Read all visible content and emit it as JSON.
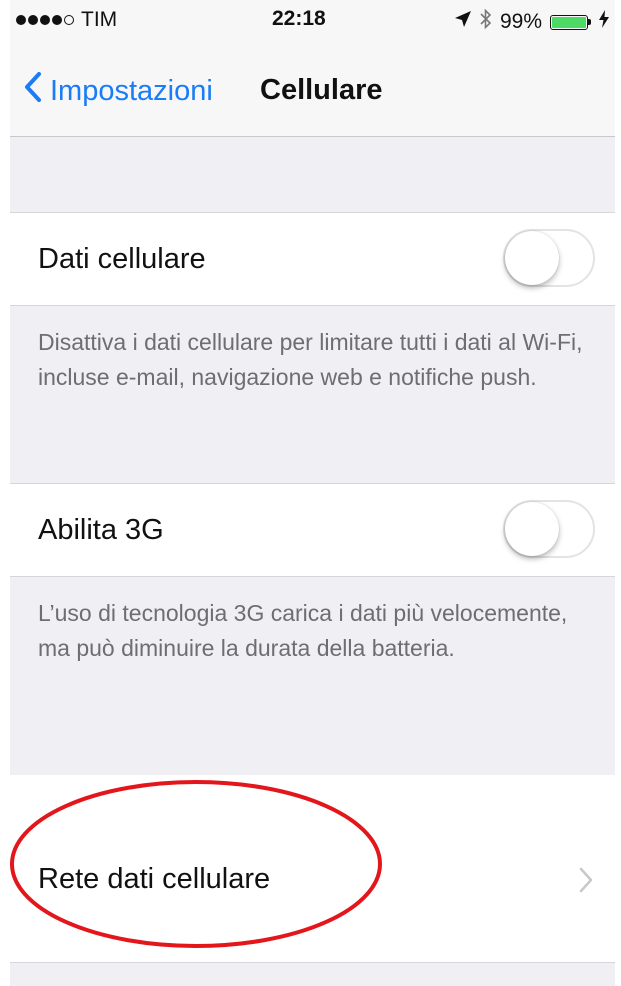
{
  "status_bar": {
    "signal_dots_filled": 4,
    "signal_dots_total": 5,
    "carrier": "TIM",
    "time": "22:18",
    "location_icon": "location-arrow-icon",
    "bluetooth_icon": "bluetooth-icon",
    "battery_percent_label": "99%",
    "battery_level": 0.99,
    "battery_color": "#4cd964",
    "charging_icon": "charging-bolt-icon"
  },
  "nav": {
    "back_label": "Impostazioni",
    "title": "Cellulare",
    "accent_color": "#1a7cf6"
  },
  "settings": {
    "cellular_data": {
      "label": "Dati cellulare",
      "enabled": false,
      "footnote": "Disattiva i dati cellulare per limitare tutti i dati al Wi-Fi, incluse e-mail, navigazione web e notifiche push."
    },
    "enable_3g": {
      "label": "Abilita 3G",
      "enabled": false,
      "footnote": "L’uso di tecnologia 3G carica i dati più velocemente, ma può diminuire la durata della batteria."
    },
    "cellular_network": {
      "label": "Rete dati cellulare"
    }
  },
  "annotation": {
    "highlight_color": "#e3161b"
  }
}
